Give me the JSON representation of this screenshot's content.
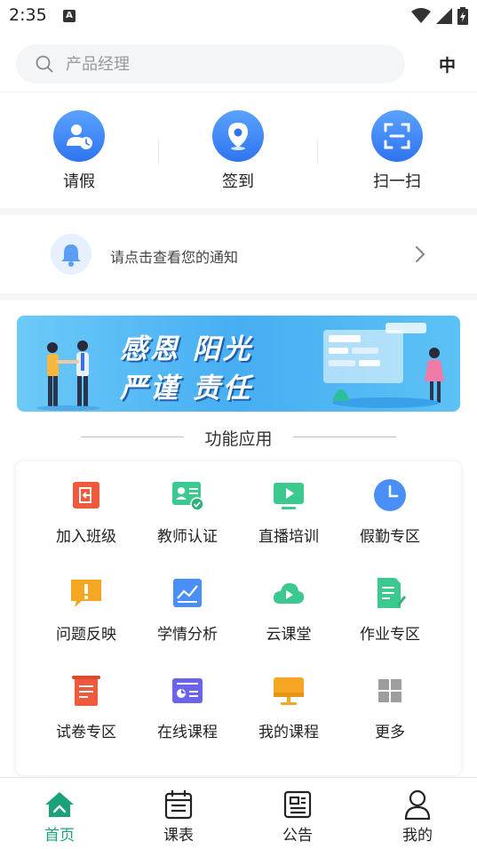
{
  "status_bar": {
    "time": "2:35",
    "notification_letter": "A"
  },
  "search": {
    "placeholder": "产品经理",
    "lang_button": "中"
  },
  "quick_actions": [
    {
      "label": "请假",
      "icon": "leave-icon"
    },
    {
      "label": "签到",
      "icon": "location-pin-icon"
    },
    {
      "label": "扫一扫",
      "icon": "scan-icon"
    }
  ],
  "notice": {
    "text": "请点击查看您的通知"
  },
  "banner": {
    "line1": "感恩  阳光",
    "line2": "严谨  责任"
  },
  "section": {
    "title": "功能应用"
  },
  "functions": [
    {
      "label": "加入班级",
      "icon": "join-class-icon",
      "color": "#ef5a3c"
    },
    {
      "label": "教师认证",
      "icon": "teacher-cert-icon",
      "color": "#3cc98f"
    },
    {
      "label": "直播培训",
      "icon": "live-play-icon",
      "color": "#3cc98f"
    },
    {
      "label": "假勤专区",
      "icon": "clock-icon",
      "color": "#4a8ff5"
    },
    {
      "label": "问题反映",
      "icon": "feedback-icon",
      "color": "#f5a623"
    },
    {
      "label": "学情分析",
      "icon": "analysis-chart-icon",
      "color": "#4a8ff5"
    },
    {
      "label": "云课堂",
      "icon": "cloud-play-icon",
      "color": "#3cc98f"
    },
    {
      "label": "作业专区",
      "icon": "homework-icon",
      "color": "#3cc98f"
    },
    {
      "label": "试卷专区",
      "icon": "exam-paper-icon",
      "color": "#ef5a3c"
    },
    {
      "label": "在线课程",
      "icon": "online-course-icon",
      "color": "#6b63e8"
    },
    {
      "label": "我的课程",
      "icon": "my-course-icon",
      "color": "#f5a623"
    },
    {
      "label": "更多",
      "icon": "more-grid-icon",
      "color": "#9e9e9e"
    }
  ],
  "bottom_nav": [
    {
      "label": "首页",
      "icon": "home-icon",
      "active": true
    },
    {
      "label": "课表",
      "icon": "calendar-icon",
      "active": false
    },
    {
      "label": "公告",
      "icon": "announcement-icon",
      "active": false
    },
    {
      "label": "我的",
      "icon": "profile-icon",
      "active": false
    }
  ],
  "colors": {
    "accent_blue": "#3d83f3",
    "active_green": "#1ba27a",
    "banner_blue": "#46aef2"
  }
}
